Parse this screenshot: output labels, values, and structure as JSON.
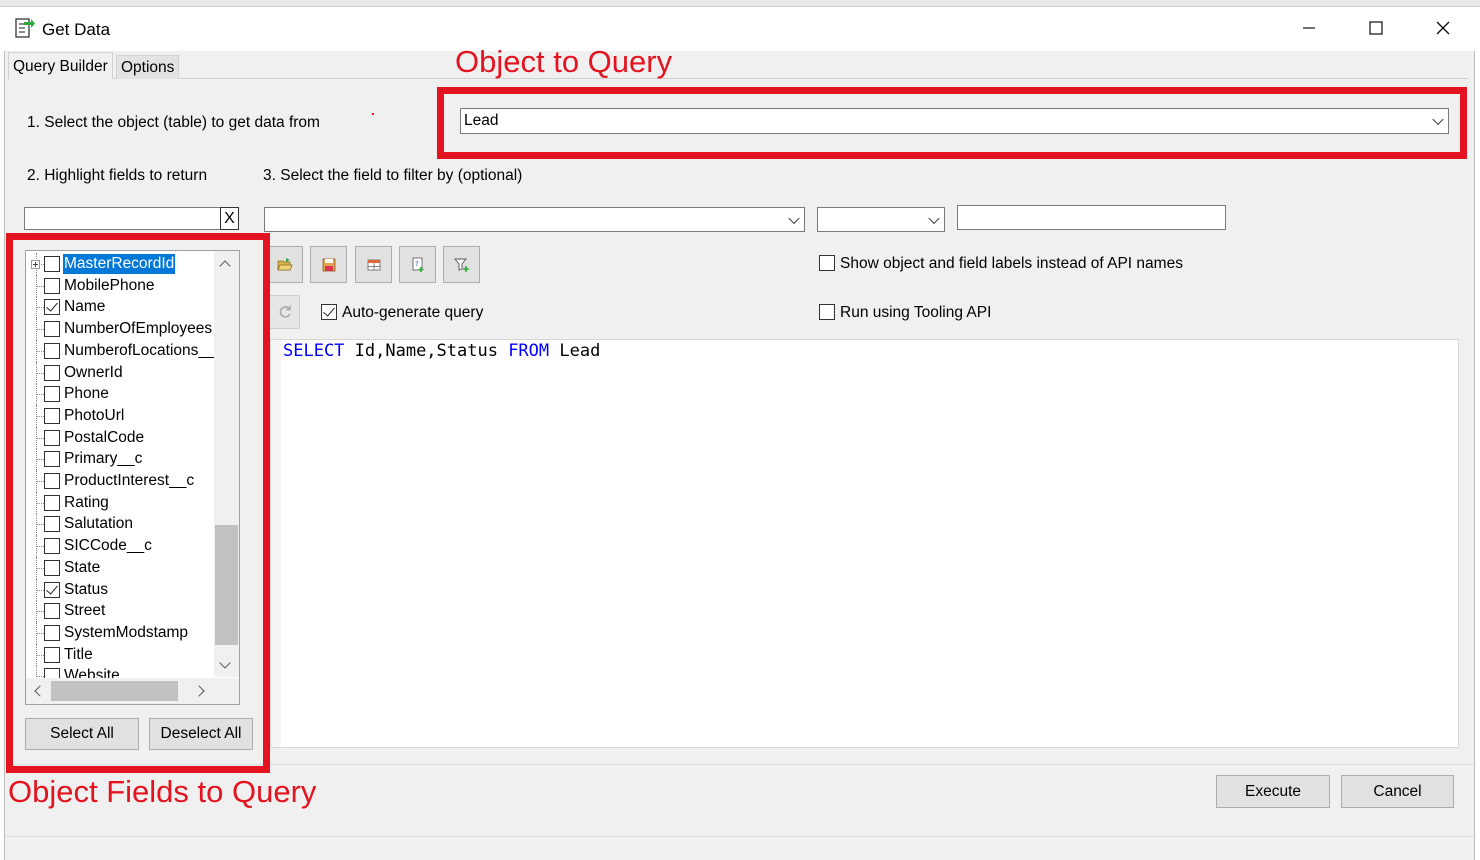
{
  "window": {
    "title": "Get Data",
    "icon": "get-data-icon",
    "controls": [
      "minimize-icon",
      "maximize-icon",
      "close-icon"
    ]
  },
  "tabs": [
    {
      "label": "Query Builder",
      "active": true
    },
    {
      "label": "Options",
      "active": false
    }
  ],
  "step1": {
    "label": "1. Select the object (table) to get data from",
    "object_value": "Lead"
  },
  "step2": {
    "label": "2. Highlight fields to return",
    "search_value": "",
    "clear_label": "X"
  },
  "step3": {
    "label": "3. Select the field to filter by (optional)",
    "filter_field_value": "",
    "operator_value": "",
    "filter_value": ""
  },
  "fields": [
    {
      "name": "MasterRecordId",
      "checked": false,
      "selected": true
    },
    {
      "name": "MobilePhone",
      "checked": false
    },
    {
      "name": "Name",
      "checked": true
    },
    {
      "name": "NumberOfEmployees",
      "checked": false
    },
    {
      "name": "NumberofLocations__",
      "checked": false
    },
    {
      "name": "OwnerId",
      "checked": false
    },
    {
      "name": "Phone",
      "checked": false
    },
    {
      "name": "PhotoUrl",
      "checked": false
    },
    {
      "name": "PostalCode",
      "checked": false
    },
    {
      "name": "Primary__c",
      "checked": false
    },
    {
      "name": "ProductInterest__c",
      "checked": false
    },
    {
      "name": "Rating",
      "checked": false
    },
    {
      "name": "Salutation",
      "checked": false
    },
    {
      "name": "SICCode__c",
      "checked": false
    },
    {
      "name": "State",
      "checked": true,
      "checked_override": false
    },
    {
      "name": "Status",
      "checked": true
    },
    {
      "name": "Street",
      "checked": false
    },
    {
      "name": "SystemModstamp",
      "checked": false
    },
    {
      "name": "Title",
      "checked": false
    },
    {
      "name": "Website",
      "checked": false
    }
  ],
  "buttons": {
    "select_all": "Select All",
    "deselect_all": "Deselect All",
    "execute": "Execute",
    "cancel": "Cancel"
  },
  "toolbar_icons": [
    "open-query-icon",
    "save-query-icon",
    "query-table-icon",
    "add-query-icon",
    "add-filter-icon"
  ],
  "options": {
    "show_labels": {
      "label": "Show object and field labels instead of API names",
      "checked": false
    },
    "auto_generate": {
      "label": "Auto-generate query",
      "checked": true
    },
    "tooling_api": {
      "label": "Run using Tooling API",
      "checked": false
    }
  },
  "query": {
    "select_kw": "SELECT",
    "fields": " Id,Name,Status ",
    "from_kw": "FROM",
    "object": " Lead"
  },
  "annotations": {
    "object_to_query": "Object to Query",
    "object_fields_to_query": "Object Fields to Query",
    "color": "#e3141f"
  }
}
